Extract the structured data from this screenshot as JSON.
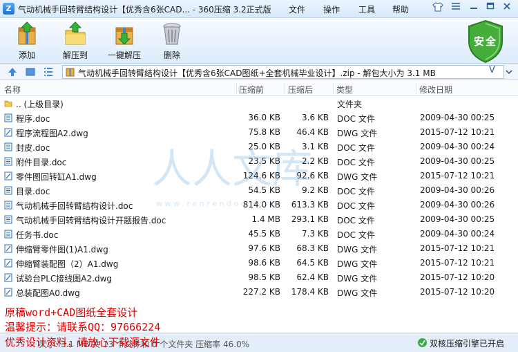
{
  "window": {
    "title": "气动机械手回转臂结构设计【优秀含6张CAD... - 360压缩 3.2正式版",
    "menu": [
      "文件",
      "操作",
      "工具",
      "帮助"
    ],
    "controls": [
      "shirt-icon",
      "menu-icon",
      "minimize-icon",
      "maximize-icon",
      "close-icon"
    ]
  },
  "toolbar": {
    "add_label": "添加",
    "extract_label": "解压到",
    "one_click_label": "一键解压",
    "delete_label": "删除",
    "security_badge": "安全"
  },
  "pathbar": {
    "path": "气动机械手回转臂结构设计【优秀含6张CAD图纸+全套机械毕业设计】.zip - 解包大小为 3.1 MB",
    "v_label": "V"
  },
  "columns": {
    "name": "名称",
    "size": "压缩前",
    "packed": "压缩后",
    "type": "类型",
    "modified": "修改日期"
  },
  "files": [
    {
      "name": ".. (上级目录)",
      "size": "",
      "packed": "",
      "type": "文件夹",
      "date": "",
      "icon": "folder-icon"
    },
    {
      "name": "程序.doc",
      "size": "36.0 KB",
      "packed": "3.6 KB",
      "type": "DOC 文件",
      "date": "2009-04-30 00:25",
      "icon": "doc-file-icon"
    },
    {
      "name": "程序流程图A2.dwg",
      "size": "75.8 KB",
      "packed": "46.4 KB",
      "type": "DWG 文件",
      "date": "2015-07-12 10:21",
      "icon": "dwg-file-icon"
    },
    {
      "name": "封皮.doc",
      "size": "25.0 KB",
      "packed": "3.1 KB",
      "type": "DOC 文件",
      "date": "2009-04-30 00:24",
      "icon": "doc-file-icon"
    },
    {
      "name": "附件目录.doc",
      "size": "23.5 KB",
      "packed": "2.2 KB",
      "type": "DOC 文件",
      "date": "2009-04-30 00:25",
      "icon": "doc-file-icon"
    },
    {
      "name": "零件图回转缸A1.dwg",
      "size": "124.6 KB",
      "packed": "92.6 KB",
      "type": "DWG 文件",
      "date": "2015-07-12 10:21",
      "icon": "dwg-file-icon"
    },
    {
      "name": "目录.doc",
      "size": "54.5 KB",
      "packed": "9.2 KB",
      "type": "DOC 文件",
      "date": "2009-04-30 00:26",
      "icon": "doc-file-icon"
    },
    {
      "name": "气动机械手回转臂结构设计.doc",
      "size": "814.0 KB",
      "packed": "613.3 KB",
      "type": "DOC 文件",
      "date": "2009-04-30 00:26",
      "icon": "doc-file-icon"
    },
    {
      "name": "气动机械手回转臂结构设计开题报告.doc",
      "size": "1.4 MB",
      "packed": "293.1 KB",
      "type": "DOC 文件",
      "date": "2009-04-30 00:25",
      "icon": "doc-file-icon"
    },
    {
      "name": "任务书.doc",
      "size": "45.5 KB",
      "packed": "7.3 KB",
      "type": "DOC 文件",
      "date": "2009-04-30 00:24",
      "icon": "doc-file-icon"
    },
    {
      "name": "伸缩臂零件图(1)A1.dwg",
      "size": "97.6 KB",
      "packed": "68.3 KB",
      "type": "DWG 文件",
      "date": "2015-07-12 10:21",
      "icon": "dwg-file-icon"
    },
    {
      "name": "伸缩臂装配图（2）A1.dwg",
      "size": "98.6 KB",
      "packed": "64.5 KB",
      "type": "DWG 文件",
      "date": "2015-07-12 10:21",
      "icon": "dwg-file-icon"
    },
    {
      "name": "试验台PLC接线图A2.dwg",
      "size": "98.5 KB",
      "packed": "62.4 KB",
      "type": "DWG 文件",
      "date": "2015-07-12 10:20",
      "icon": "dwg-file-icon"
    },
    {
      "name": "总装配图A0.dwg",
      "size": "227.2 KB",
      "packed": "178.4 KB",
      "type": "DWG 文件",
      "date": "2015-07-12 10:20",
      "icon": "dwg-file-icon"
    }
  ],
  "watermark": {
    "text": "人人文库",
    "url": "w w w . r e n r e n d o c . c o m"
  },
  "overlay_notes": [
    "原稿word+CAD图纸全套设计",
    "温馨提示：请联系QQ：97666224",
    "优秀设计资料，请放心下载源文件"
  ],
  "status": {
    "left": "大小: 3.1 MB 共 13 个文件和 0 个文件夹 压缩率 46.0%",
    "engine": "双核压缩引擎已开启"
  },
  "colors": {
    "accent": "#2a72c6",
    "security_green": "#3fa73a",
    "note_red": "#e00000"
  }
}
